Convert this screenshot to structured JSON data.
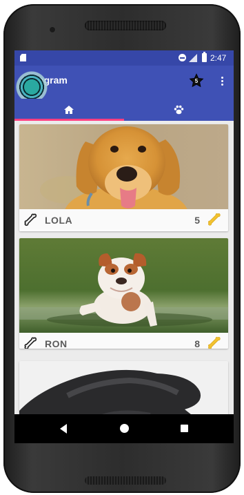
{
  "status_bar": {
    "time": "2:47",
    "icons": [
      "sd-card-icon",
      "do-not-disturb-icon",
      "signal-icon",
      "battery-icon"
    ]
  },
  "app_bar": {
    "title": "Petagram",
    "favorites_badge": "5",
    "actions": [
      "star-icon",
      "overflow-menu-icon"
    ]
  },
  "tabs": [
    {
      "icon": "home-icon",
      "selected": true
    },
    {
      "icon": "paw-icon",
      "selected": false
    }
  ],
  "pets": [
    {
      "name": "LOLA",
      "rating": "5",
      "photo": "golden retriever puppy",
      "like_icon": "bone-outline-icon",
      "rating_icon": "bone-gold-icon"
    },
    {
      "name": "RON",
      "rating": "8",
      "photo": "bulldog puppy",
      "like_icon": "bone-outline-icon",
      "rating_icon": "bone-gold-icon"
    }
  ],
  "nav_bar": [
    "back-icon",
    "home-circle-icon",
    "recents-icon"
  ],
  "colors": {
    "primary": "#3f51b5",
    "primary_dark": "#3647a8",
    "accent": "#ff4081",
    "bone_gold": "#f2c230"
  }
}
